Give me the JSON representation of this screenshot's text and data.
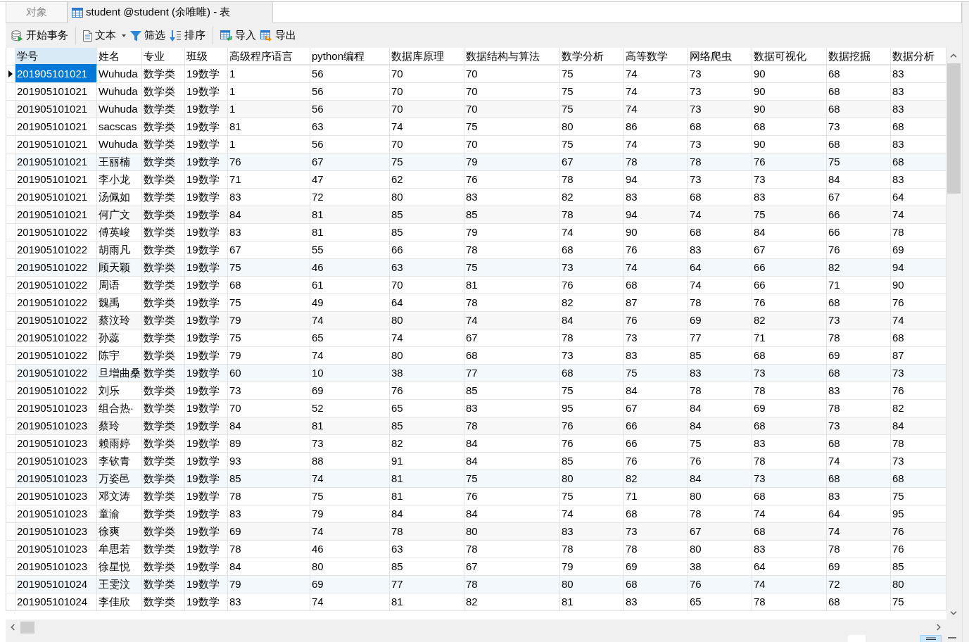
{
  "tabs": [
    {
      "label": "对象",
      "kind": "objects",
      "selected": false
    },
    {
      "label": "student @student (余唯唯) - 表",
      "kind": "table",
      "selected": true
    }
  ],
  "toolbar": {
    "groups": [
      {
        "items": [
          {
            "label": "开始事务",
            "kind": "transaction",
            "dropdown": false
          }
        ]
      },
      {
        "items": [
          {
            "label": "文本",
            "kind": "text",
            "dropdown": true
          },
          {
            "label": "筛选",
            "kind": "filter",
            "dropdown": false
          },
          {
            "label": "排序",
            "kind": "sort",
            "dropdown": false
          }
        ]
      },
      {
        "items": [
          {
            "label": "导入",
            "kind": "import",
            "dropdown": false
          },
          {
            "label": "导出",
            "kind": "export",
            "dropdown": false
          }
        ]
      }
    ]
  },
  "table": {
    "columns": [
      {
        "label": "学号",
        "selected": true
      },
      {
        "label": "姓名",
        "selected": false
      },
      {
        "label": "专业",
        "selected": false
      },
      {
        "label": "班级",
        "selected": false
      },
      {
        "label": "高级程序语言",
        "selected": false
      },
      {
        "label": "python编程",
        "selected": false
      },
      {
        "label": "数据库原理",
        "selected": false
      },
      {
        "label": "数据结构与算法",
        "selected": false
      },
      {
        "label": "数学分析",
        "selected": false
      },
      {
        "label": "高等数学",
        "selected": false
      },
      {
        "label": "网络爬虫",
        "selected": false
      },
      {
        "label": "数据可视化",
        "selected": false
      },
      {
        "label": "数据挖掘",
        "selected": false
      },
      {
        "label": "数据分析",
        "selected": false
      }
    ],
    "rows": [
      {
        "selected": true,
        "cells": [
          "201905101021",
          "Wuhuda",
          "数学类",
          "19数学",
          "1",
          "56",
          "70",
          "70",
          "75",
          "74",
          "73",
          "90",
          "68",
          "83"
        ]
      },
      {
        "selected": false,
        "cells": [
          "201905101021",
          "Wuhuda",
          "数学类",
          "19数学",
          "1",
          "56",
          "70",
          "70",
          "75",
          "74",
          "73",
          "90",
          "68",
          "83"
        ]
      },
      {
        "selected": false,
        "cells": [
          "201905101021",
          "Wuhuda",
          "数学类",
          "19数学",
          "1",
          "56",
          "70",
          "70",
          "75",
          "74",
          "73",
          "90",
          "68",
          "83"
        ]
      },
      {
        "selected": false,
        "cells": [
          "201905101021",
          "sacscas",
          "数学类",
          "19数学",
          "81",
          "63",
          "74",
          "75",
          "80",
          "86",
          "68",
          "68",
          "73",
          "68"
        ]
      },
      {
        "selected": false,
        "cells": [
          "201905101021",
          "Wuhuda",
          "数学类",
          "19数学",
          "1",
          "56",
          "70",
          "70",
          "75",
          "74",
          "73",
          "90",
          "68",
          "83"
        ]
      },
      {
        "selected": false,
        "cells": [
          "201905101021",
          "王丽楠",
          "数学类",
          "19数学",
          "76",
          "67",
          "75",
          "79",
          "67",
          "78",
          "78",
          "76",
          "75",
          "68"
        ]
      },
      {
        "selected": false,
        "cells": [
          "201905101021",
          "李小龙",
          "数学类",
          "19数学",
          "71",
          "47",
          "62",
          "76",
          "78",
          "94",
          "73",
          "73",
          "84",
          "83"
        ]
      },
      {
        "selected": false,
        "cells": [
          "201905101021",
          "汤佩如",
          "数学类",
          "19数学",
          "83",
          "72",
          "80",
          "83",
          "82",
          "83",
          "68",
          "83",
          "67",
          "64"
        ]
      },
      {
        "selected": false,
        "cells": [
          "201905101021",
          "何广文",
          "数学类",
          "19数学",
          "84",
          "81",
          "85",
          "85",
          "78",
          "94",
          "74",
          "75",
          "66",
          "74"
        ]
      },
      {
        "selected": false,
        "cells": [
          "201905101022",
          "傅英峻",
          "数学类",
          "19数学",
          "83",
          "81",
          "85",
          "79",
          "74",
          "90",
          "68",
          "84",
          "66",
          "78"
        ]
      },
      {
        "selected": false,
        "cells": [
          "201905101022",
          "胡雨凡",
          "数学类",
          "19数学",
          "67",
          "55",
          "66",
          "78",
          "68",
          "76",
          "83",
          "67",
          "76",
          "69"
        ]
      },
      {
        "selected": false,
        "cells": [
          "201905101022",
          "顾天颖",
          "数学类",
          "19数学",
          "75",
          "46",
          "63",
          "75",
          "73",
          "74",
          "64",
          "66",
          "82",
          "94"
        ]
      },
      {
        "selected": false,
        "cells": [
          "201905101022",
          "周语",
          "数学类",
          "19数学",
          "68",
          "61",
          "70",
          "81",
          "76",
          "68",
          "74",
          "66",
          "71",
          "90"
        ]
      },
      {
        "selected": false,
        "cells": [
          "201905101022",
          "魏禹",
          "数学类",
          "19数学",
          "75",
          "49",
          "64",
          "78",
          "82",
          "87",
          "78",
          "76",
          "68",
          "76"
        ]
      },
      {
        "selected": false,
        "cells": [
          "201905101022",
          "蔡汶玲",
          "数学类",
          "19数学",
          "79",
          "74",
          "80",
          "74",
          "84",
          "76",
          "69",
          "82",
          "73",
          "74"
        ]
      },
      {
        "selected": false,
        "cells": [
          "201905101022",
          "孙蕊",
          "数学类",
          "19数学",
          "75",
          "65",
          "74",
          "67",
          "78",
          "73",
          "77",
          "71",
          "78",
          "68"
        ]
      },
      {
        "selected": false,
        "cells": [
          "201905101022",
          "陈宇",
          "数学类",
          "19数学",
          "79",
          "74",
          "80",
          "68",
          "73",
          "83",
          "85",
          "68",
          "69",
          "87"
        ]
      },
      {
        "selected": false,
        "cells": [
          "201905101022",
          "旦增曲桑",
          "数学类",
          "19数学",
          "60",
          "10",
          "38",
          "77",
          "68",
          "75",
          "83",
          "73",
          "68",
          "73"
        ]
      },
      {
        "selected": false,
        "cells": [
          "201905101022",
          "刘乐",
          "数学类",
          "19数学",
          "73",
          "69",
          "76",
          "85",
          "75",
          "84",
          "78",
          "78",
          "83",
          "76"
        ]
      },
      {
        "selected": false,
        "cells": [
          "201905101023",
          "组合热·",
          "数学类",
          "19数学",
          "70",
          "52",
          "65",
          "83",
          "95",
          "67",
          "84",
          "69",
          "78",
          "82"
        ]
      },
      {
        "selected": false,
        "cells": [
          "201905101023",
          "蔡玲",
          "数学类",
          "19数学",
          "84",
          "81",
          "85",
          "78",
          "76",
          "66",
          "84",
          "68",
          "73",
          "84"
        ]
      },
      {
        "selected": false,
        "cells": [
          "201905101023",
          "赖雨婷",
          "数学类",
          "19数学",
          "89",
          "73",
          "82",
          "84",
          "76",
          "66",
          "75",
          "83",
          "68",
          "78"
        ]
      },
      {
        "selected": false,
        "cells": [
          "201905101023",
          "李钦青",
          "数学类",
          "19数学",
          "93",
          "88",
          "91",
          "84",
          "85",
          "76",
          "76",
          "78",
          "74",
          "73"
        ]
      },
      {
        "selected": false,
        "cells": [
          "201905101023",
          "万姿邑",
          "数学类",
          "19数学",
          "85",
          "74",
          "81",
          "75",
          "80",
          "82",
          "84",
          "73",
          "68",
          "68"
        ]
      },
      {
        "selected": false,
        "cells": [
          "201905101023",
          "邓文涛",
          "数学类",
          "19数学",
          "78",
          "75",
          "81",
          "76",
          "75",
          "71",
          "80",
          "68",
          "83",
          "75"
        ]
      },
      {
        "selected": false,
        "cells": [
          "201905101023",
          "童渝",
          "数学类",
          "19数学",
          "83",
          "79",
          "84",
          "84",
          "74",
          "68",
          "78",
          "74",
          "64",
          "95"
        ]
      },
      {
        "selected": false,
        "cells": [
          "201905101023",
          "徐爽",
          "数学类",
          "19数学",
          "69",
          "74",
          "78",
          "80",
          "83",
          "73",
          "67",
          "68",
          "74",
          "76"
        ]
      },
      {
        "selected": false,
        "cells": [
          "201905101023",
          "牟思若",
          "数学类",
          "19数学",
          "78",
          "46",
          "63",
          "78",
          "78",
          "78",
          "80",
          "83",
          "78",
          "76"
        ]
      },
      {
        "selected": false,
        "cells": [
          "201905101023",
          "徐星悦",
          "数学类",
          "19数学",
          "84",
          "80",
          "85",
          "67",
          "79",
          "69",
          "38",
          "64",
          "69",
          "85"
        ]
      },
      {
        "selected": false,
        "cells": [
          "201905101024",
          "王雯汶",
          "数学类",
          "19数学",
          "79",
          "69",
          "77",
          "78",
          "80",
          "68",
          "76",
          "74",
          "72",
          "80"
        ]
      },
      {
        "selected": false,
        "cells": [
          "201905101024",
          "李佳欣",
          "数学类",
          "19数学",
          "83",
          "74",
          "81",
          "82",
          "81",
          "83",
          "65",
          "78",
          "68",
          "75"
        ]
      }
    ]
  },
  "status_bar": {
    "views": [
      {
        "kind": "grid",
        "selected": true
      },
      {
        "kind": "form",
        "selected": false
      }
    ]
  }
}
